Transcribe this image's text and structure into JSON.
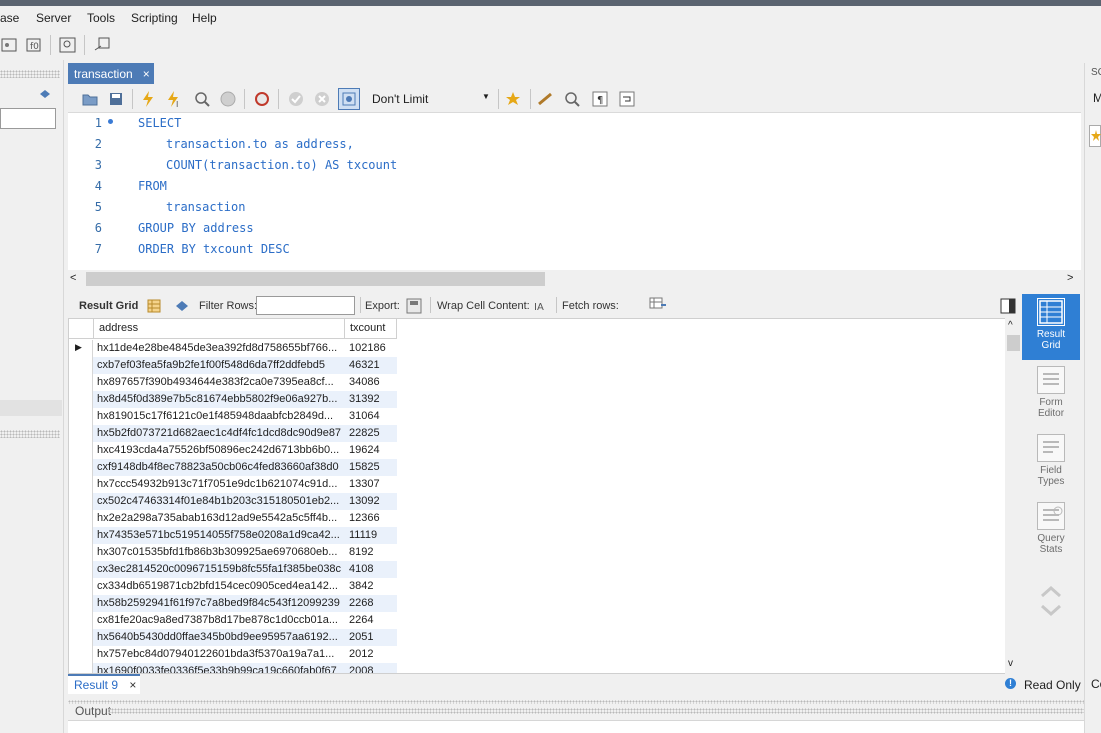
{
  "menu": {
    "items": [
      "ase",
      "Server",
      "Tools",
      "Scripting",
      "Help"
    ]
  },
  "editor_tab": {
    "label": "transaction",
    "close": "×"
  },
  "limit_select": {
    "value": "Don't Limit"
  },
  "sql_lines": [
    {
      "n": "1",
      "text": "SELECT"
    },
    {
      "n": "2",
      "text": "transaction.to as address,"
    },
    {
      "n": "3",
      "text": "COUNT(transaction.to) AS txcount"
    },
    {
      "n": "4",
      "text": "FROM"
    },
    {
      "n": "5",
      "text": "transaction"
    },
    {
      "n": "6",
      "text": "GROUP BY address"
    },
    {
      "n": "7",
      "text": "ORDER BY txcount DESC"
    }
  ],
  "result_toolbar": {
    "result_grid": "Result Grid",
    "filter_rows": "Filter Rows:",
    "export": "Export:",
    "wrap": "Wrap Cell Content:",
    "fetch": "Fetch rows:"
  },
  "grid": {
    "columns": [
      "address",
      "txcount"
    ],
    "rows": [
      [
        "hx11de4e28be4845de3ea392fd8d758655bf766...",
        "102186"
      ],
      [
        "cxb7ef03fea5fa9b2fe1f00f548d6da7ff2ddfebd5",
        "46321"
      ],
      [
        "hx897657f390b4934644e383f2ca0e7395ea8cf...",
        "34086"
      ],
      [
        "hx8d45f0d389e7b5c81674ebb5802f9e06a927b...",
        "31392"
      ],
      [
        "hx819015c17f6121c0e1f485948daabfcb2849d...",
        "31064"
      ],
      [
        "hx5b2fd073721d682aec1c4df4fc1dcd8dc90d9e87",
        "22825"
      ],
      [
        "hxc4193cda4a75526bf50896ec242d6713bb6b0...",
        "19624"
      ],
      [
        "cxf9148db4f8ec78823a50cb06c4fed83660af38d0",
        "15825"
      ],
      [
        "hx7ccc54932b913c71f7051e9dc1b621074c91d...",
        "13307"
      ],
      [
        "cx502c47463314f01e84b1b203c315180501eb2...",
        "13092"
      ],
      [
        "hx2e2a298a735abab163d12ad9e5542a5c5ff4b...",
        "12366"
      ],
      [
        "hx74353e571bc519514055f758e0208a1d9ca42...",
        "11119"
      ],
      [
        "hx307c01535bfd1fb86b3b309925ae6970680eb...",
        "8192"
      ],
      [
        "cx3ec2814520c0096715159b8fc55fa1f385be038c",
        "4108"
      ],
      [
        "cx334db6519871cb2bfd154cec0905ced4ea142...",
        "3842"
      ],
      [
        "hx58b2592941f61f97c7a8bed9f84c543f12099239",
        "2268"
      ],
      [
        "cx81fe20ac9a8ed7387b8d17be878c1d0ccb01a...",
        "2264"
      ],
      [
        "hx5640b5430dd0ffae345b0bd9ee95957aa6192...",
        "2051"
      ],
      [
        "hx757ebc84d07940122601bda3f5370a19a7a1...",
        "2012"
      ],
      [
        "hx1690f0033fe0336f5e33b9b99ca19c660fab0f67",
        "2008"
      ]
    ]
  },
  "side_panel": [
    {
      "label1": "Result",
      "label2": "Grid"
    },
    {
      "label1": "Form",
      "label2": "Editor"
    },
    {
      "label1": "Field",
      "label2": "Types"
    },
    {
      "label1": "Query",
      "label2": "Stats"
    }
  ],
  "result_tab": {
    "label": "Result 9",
    "close": "×"
  },
  "status": {
    "read_only": "Read Only"
  },
  "output": {
    "label": "Output"
  },
  "right_edge": {
    "sc": "SC",
    "m": "M",
    "co": "Co"
  },
  "colors": {
    "accent": "#2f7fd4",
    "tab": "#4d7bb6",
    "keyword": "#2b6dc7"
  }
}
